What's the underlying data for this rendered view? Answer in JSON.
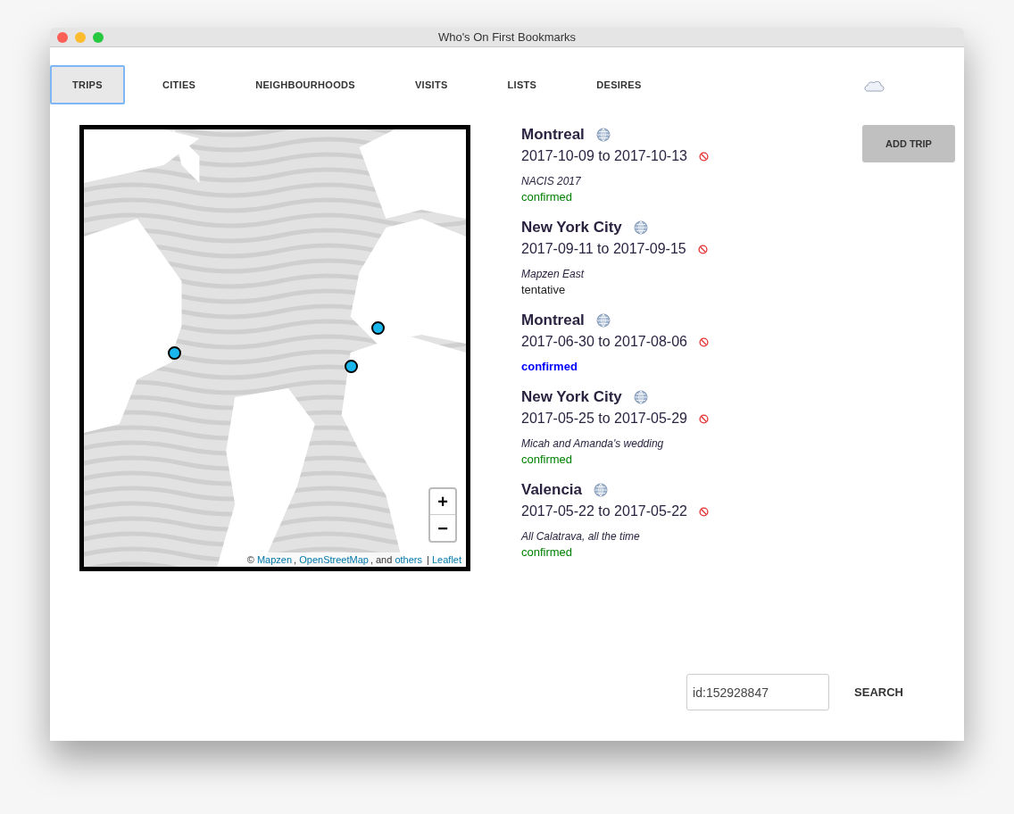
{
  "window": {
    "title": "Who's On First Bookmarks"
  },
  "tabs": [
    {
      "label": "TRIPS",
      "selected": true
    },
    {
      "label": "CITIES",
      "selected": false
    },
    {
      "label": "NEIGHBOURHOODS",
      "selected": false
    },
    {
      "label": "VISITS",
      "selected": false
    },
    {
      "label": "LISTS",
      "selected": false
    },
    {
      "label": "DESIRES",
      "selected": false
    }
  ],
  "map": {
    "zoom_in": "+",
    "zoom_out": "−",
    "attribution": [
      {
        "text": "Mapzen",
        "link": true
      },
      {
        "text": ", ",
        "link": false
      },
      {
        "text": "OpenStreetMap",
        "link": true
      },
      {
        "text": ", and ",
        "link": false
      },
      {
        "text": "others",
        "link": true
      },
      {
        "text": " | ",
        "link": false
      },
      {
        "text": "Leaflet",
        "link": true
      }
    ],
    "copyright": "©"
  },
  "trips": [
    {
      "city": "Montreal",
      "dates": "2017-10-09 to 2017-10-13",
      "note": "NACIS 2017",
      "status": "confirmed",
      "color": "#008000",
      "highlighted": false
    },
    {
      "city": "New York City",
      "dates": "2017-09-11 to 2017-09-15",
      "note": "Mapzen East",
      "status": "tentative",
      "color": "#222222",
      "highlighted": false
    },
    {
      "city": "Montreal",
      "dates": "2017-06-30 to 2017-08-06",
      "status": "confirmed",
      "color": "#0000ff",
      "highlighted": true
    },
    {
      "city": "New York City",
      "dates": "2017-05-25 to 2017-05-29",
      "note": "Micah and Amanda's wedding",
      "status": "confirmed",
      "color": "#008000",
      "highlighted": false
    },
    {
      "city": "Valencia",
      "dates": "2017-05-22 to 2017-05-22",
      "note": "All Calatrava, all the time",
      "status": "confirmed",
      "color": "#008000",
      "highlighted": false
    }
  ],
  "add_button": "ADD TRIP",
  "search": {
    "value": "id:152928847",
    "button": "SEARCH"
  }
}
